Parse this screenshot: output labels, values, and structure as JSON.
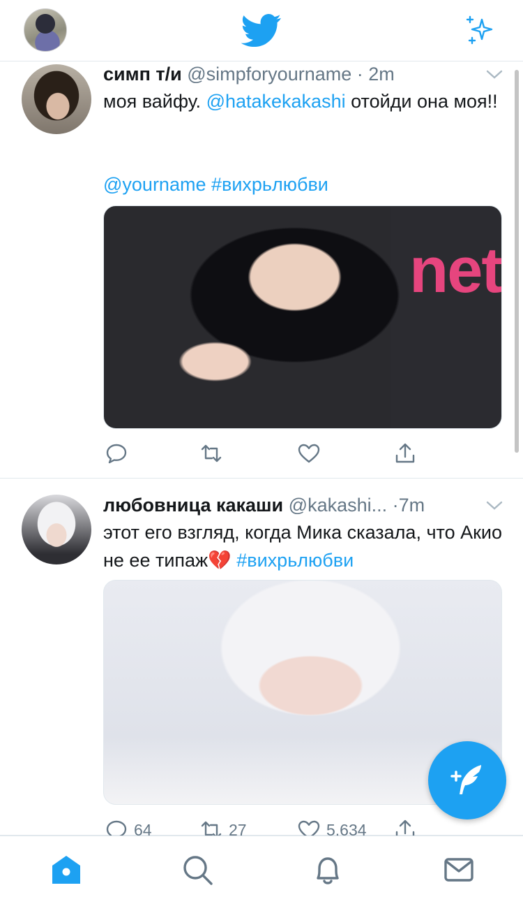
{
  "topbar": {
    "avatar_icon": "profile-avatar",
    "logo_icon": "twitter-bird-icon",
    "sparkle_icon": "sparkle-icon",
    "accent": "#1da1f2"
  },
  "tweets": [
    {
      "name": "симп т/и",
      "handle": "@simpforyourname",
      "dot": "·",
      "time": "2m",
      "text_pre": "моя вайфу. ",
      "mention": "@hatakekakashi",
      "text_post": " отойди она моя!!",
      "tags": "@yourname #вихрьлюбви",
      "media_text": "net",
      "counts": {
        "reply": "",
        "retweet": "",
        "like": ""
      }
    },
    {
      "name": "любовница какаши",
      "handle": "@kakashi...",
      "dot": "·",
      "time": "7m",
      "text_pre": "этот его взгляд, когда Мика сказала, что Акио не ее типаж",
      "emoji": "💔",
      "hashtag": " #вихрьлюбви",
      "counts": {
        "reply": "64",
        "retweet": "27",
        "like": "5.634"
      }
    }
  ],
  "tabs": [
    "home-icon",
    "search-icon",
    "notifications-icon",
    "messages-icon"
  ]
}
